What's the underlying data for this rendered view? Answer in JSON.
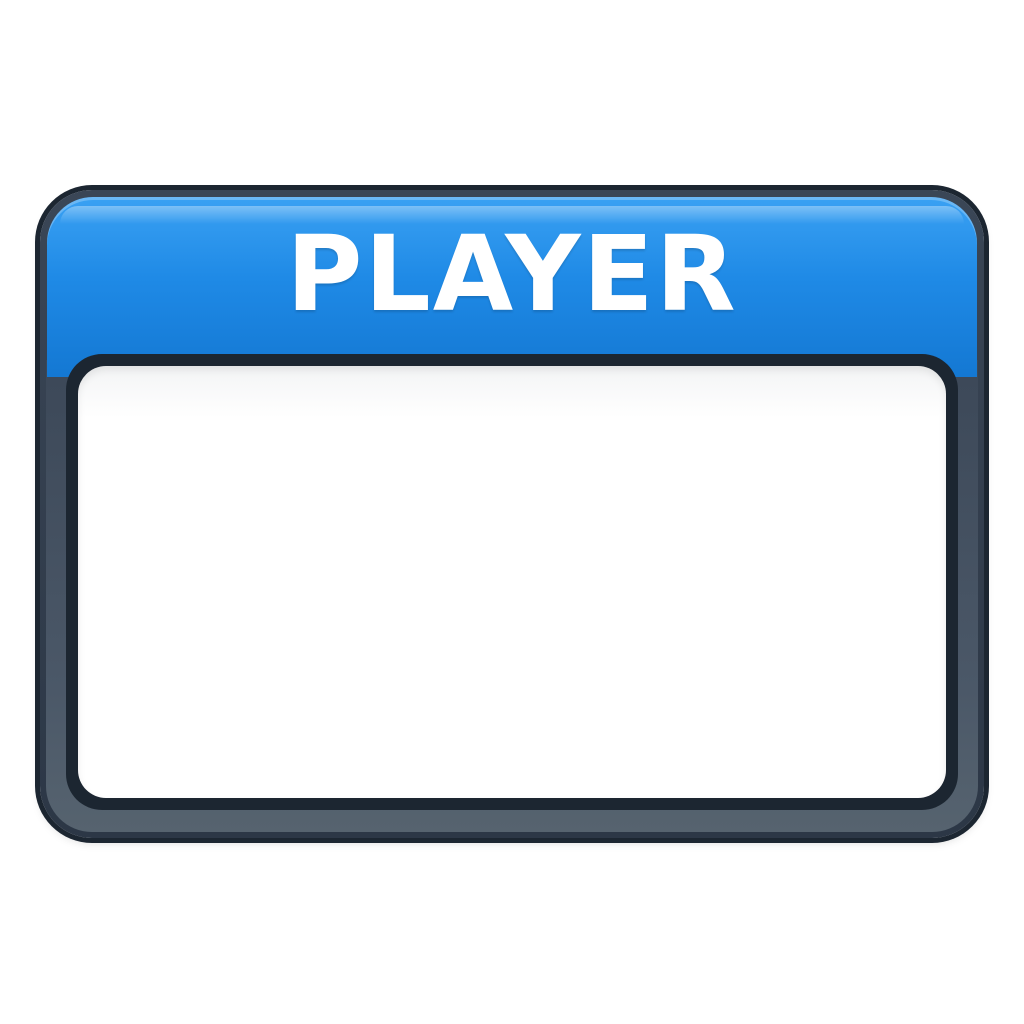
{
  "nameplate": {
    "title": "PLAYER",
    "colors": {
      "header_blue": "#1f8ae6",
      "frame_dark": "#2c3746",
      "panel_white": "#ffffff"
    }
  }
}
